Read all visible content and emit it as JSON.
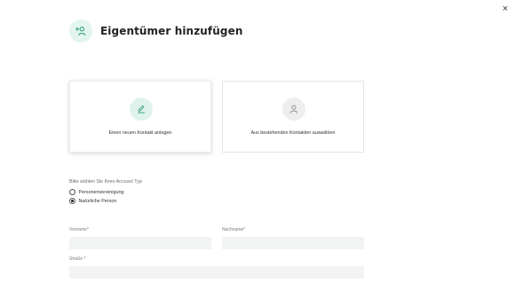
{
  "header": {
    "title": "Eigentümer hinzufügen",
    "icon": "add-person-icon"
  },
  "close": {
    "label": "×",
    "icon": "close-icon"
  },
  "options": {
    "new_contact": {
      "label": "Einen neuen Kontakt anlegen",
      "icon": "pencil-icon",
      "selected": true
    },
    "existing_contact": {
      "label": "Aus bestehenden Kontakten auswählen",
      "icon": "person-icon",
      "selected": false
    }
  },
  "account_type": {
    "label": "Bitte wählen Sie Ihren Account Typ",
    "choices": [
      {
        "label": "Personenvereinigung",
        "checked": false
      },
      {
        "label": "Natürliche Person",
        "checked": true
      }
    ]
  },
  "form": {
    "vorname": {
      "label": "Vorname*",
      "value": ""
    },
    "nachname": {
      "label": "Nachname*",
      "value": ""
    },
    "strasse": {
      "label": "Straße *",
      "value": ""
    }
  },
  "colors": {
    "accent": "#3aa57c",
    "accent_light": "#e3f5ef",
    "input_bg": "#f2f3f3"
  }
}
